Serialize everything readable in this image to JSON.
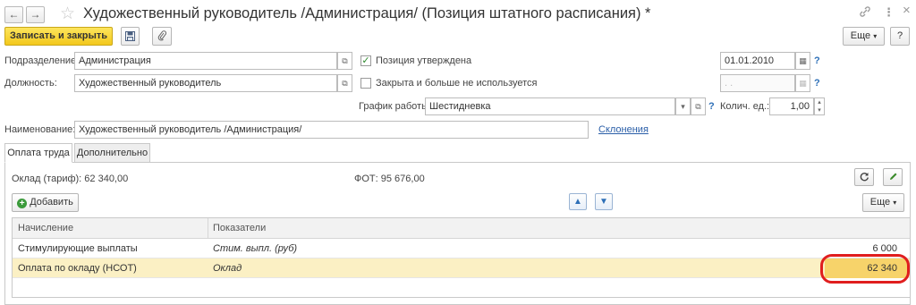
{
  "window": {
    "title": "Художественный руководитель /Администрация/ (Позиция штатного расписания) *",
    "nav_back": "←",
    "nav_forward": "→",
    "star": "☆",
    "link_icon": "🔗",
    "more_icon": "⋮",
    "close_icon": "×"
  },
  "toolbar": {
    "save_close_label": "Записать и закрыть",
    "more_label": "Еще",
    "help_label": "?"
  },
  "form": {
    "division_label": "Подразделение:",
    "division_value": "Администрация",
    "position_label": "Должность:",
    "position_value": "Художественный руководитель",
    "approved_label": "Позиция утверждена",
    "approved_checked": "✓",
    "closed_label": "Закрыта и больше не используется",
    "approved_date": "01.01.2010",
    "closed_date_placeholder": ". .",
    "schedule_label": "График работы:",
    "schedule_value": "Шестидневка",
    "qty_label": "Колич. ед.:",
    "qty_value": "1,00",
    "name_label": "Наименование:",
    "name_value": "Художественный руководитель /Администрация/",
    "declensions_link": "Склонения",
    "help_q": "?"
  },
  "tabs": [
    {
      "label": "Оплата труда",
      "active": true
    },
    {
      "label": "Дополнительно",
      "active": false
    }
  ],
  "pay": {
    "salary_text": "Оклад (тариф): 62 340,00",
    "fot_text": "ФОТ: 95 676,00",
    "add_label": "Добавить",
    "more_label": "Еще"
  },
  "grid": {
    "columns": [
      "Начисление",
      "Показатели"
    ],
    "rows": [
      {
        "accrual": "Стимулирующие выплаты",
        "indicator": "Стим. выпл. (руб)",
        "value": "6 000"
      },
      {
        "accrual": "Оплата по окладу (НСОТ)",
        "indicator": "Оклад",
        "value": "62 340"
      }
    ]
  },
  "colors": {
    "accent_yellow": "#f3c81c",
    "selected_row": "#fbf0c4",
    "highlight_circle": "#e01e1e",
    "link": "#2a5ea8"
  }
}
